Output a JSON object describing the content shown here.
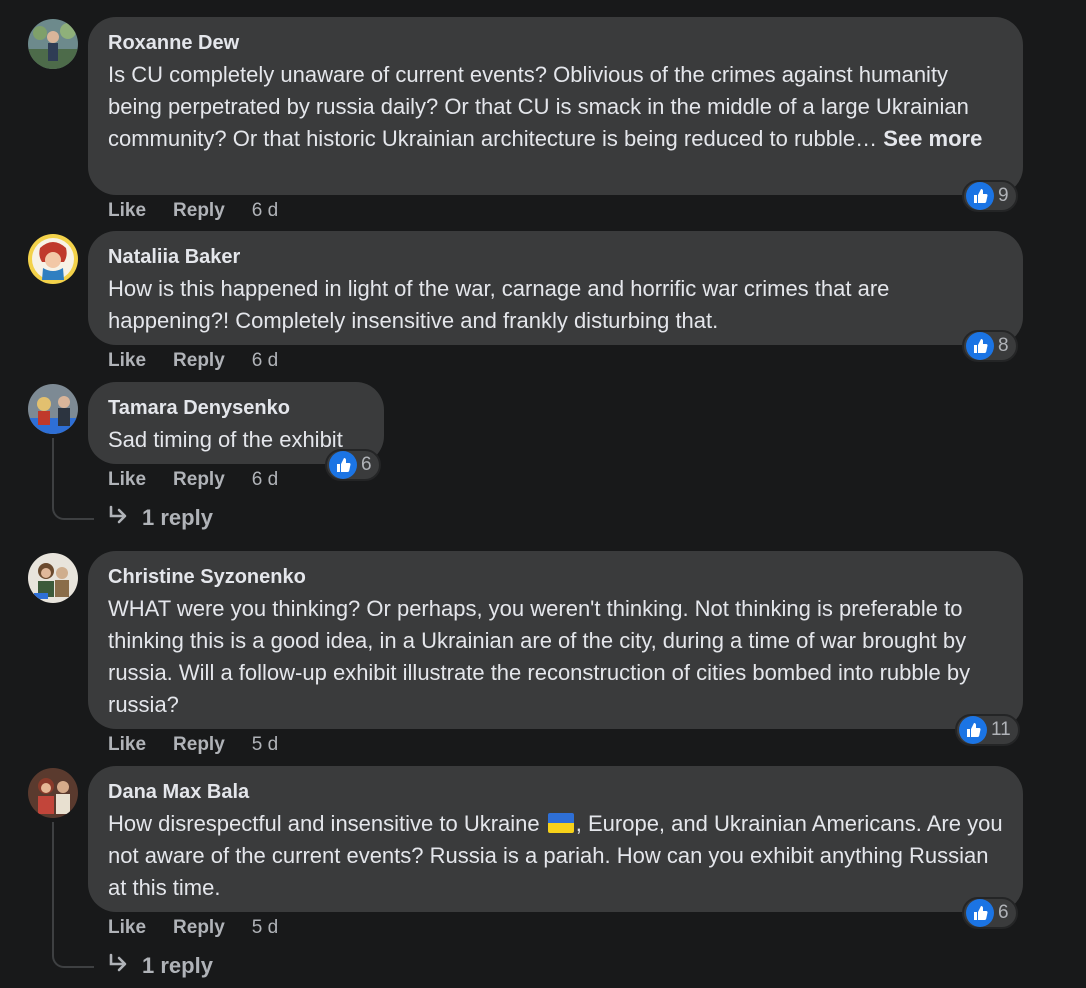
{
  "comments": [
    {
      "author": "Roxanne Dew",
      "text": "Is CU completely unaware of current events? Oblivious of the crimes against humanity being perpetrated by russia daily? Or that CU is smack in the middle of a large Ukrainian community? Or that historic Ukrainian architecture is being reduced to rubble…",
      "see_more": "See more",
      "like": "Like",
      "reply": "Reply",
      "time": "6 d",
      "reactions": "9"
    },
    {
      "author": "Nataliia Baker",
      "text": "How is this happened in light of the war, carnage and horrific war crimes that are happening?! Completely insensitive and frankly disturbing that.",
      "like": "Like",
      "reply": "Reply",
      "time": "6 d",
      "reactions": "8"
    },
    {
      "author": "Tamara Denysenko",
      "text": "Sad timing of the exhibit",
      "like": "Like",
      "reply": "Reply",
      "time": "6 d",
      "reactions": "6",
      "replies": "1 reply"
    },
    {
      "author": "Christine Syzonenko",
      "text": "WHAT were you thinking? Or perhaps, you weren't thinking. Not thinking is preferable to thinking this is a good idea, in a Ukrainian are of the city, during a time of war brought by russia. Will a follow-up exhibit illustrate the reconstruction of cities bombed into rubble by russia?",
      "like": "Like",
      "reply": "Reply",
      "time": "5 d",
      "reactions": "11"
    },
    {
      "author": "Dana Max Bala",
      "text_before_flag": "How disrespectful and insensitive to Ukraine ",
      "text_after_flag": ", Europe, and Ukrainian Americans. Are you not aware of the current events? Russia is a pariah. How can you exhibit anything Russian at this time.",
      "like": "Like",
      "reply": "Reply",
      "time": "5 d",
      "reactions": "6",
      "replies": "1 reply"
    }
  ],
  "icons": {
    "like_reaction": "thumbs-up-icon",
    "reply_arrow": "reply-arrow-icon",
    "flag": "ukraine-flag-icon"
  },
  "colors": {
    "background": "#18191a",
    "bubble": "#3a3b3c",
    "like_blue": "#1b74e4",
    "secondary_text": "#b0b3b8"
  }
}
